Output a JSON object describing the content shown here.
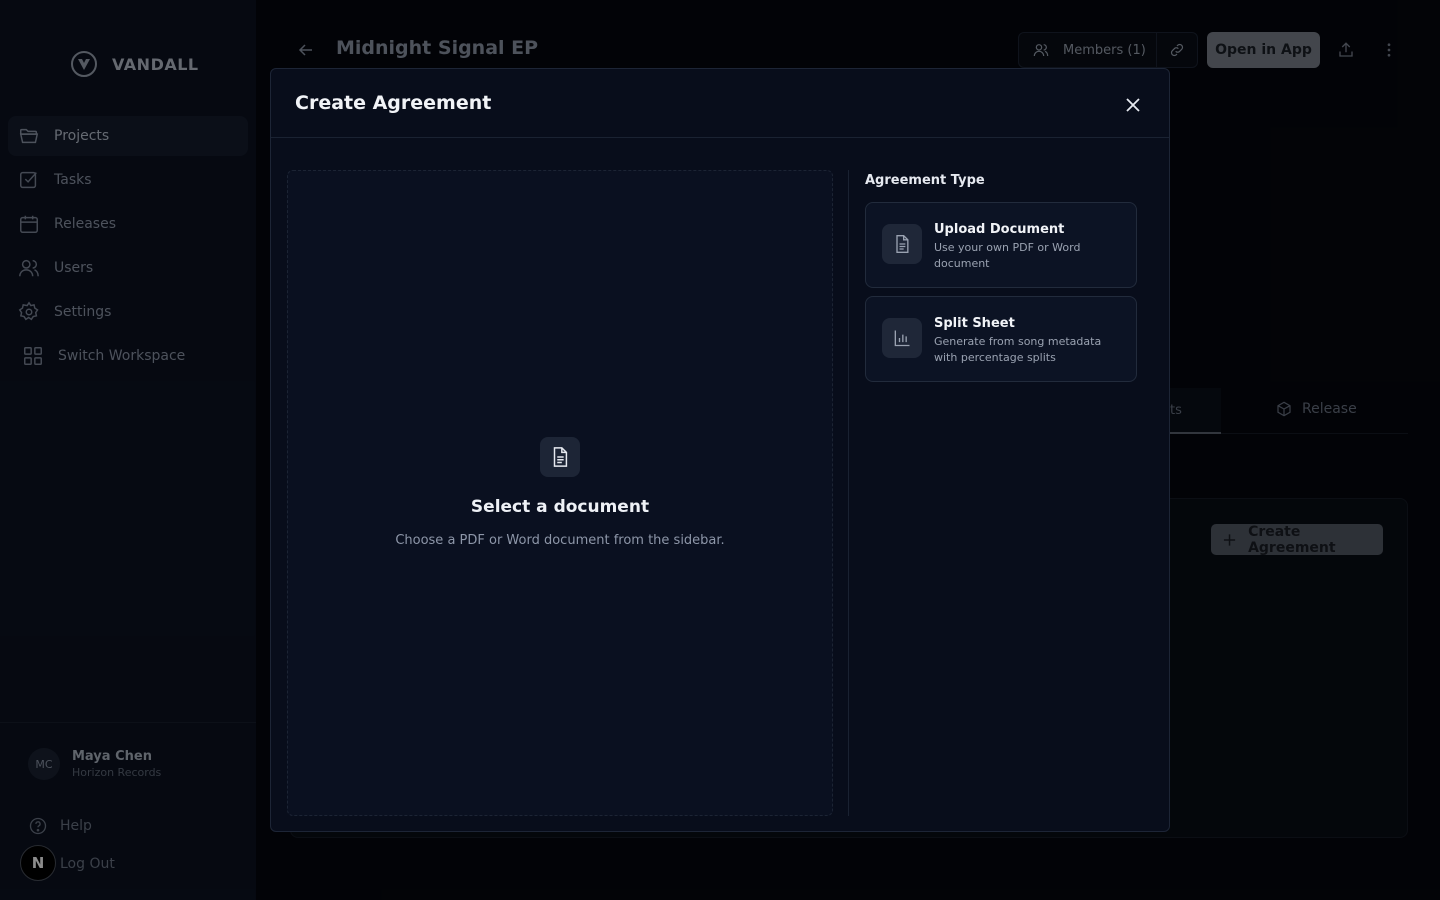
{
  "brand": {
    "name": "VANDALL"
  },
  "sidebar": {
    "items": [
      {
        "label": "Projects",
        "icon": "folder-icon",
        "active": true
      },
      {
        "label": "Tasks",
        "icon": "checkbox-icon"
      },
      {
        "label": "Releases",
        "icon": "calendar-icon"
      },
      {
        "label": "Users",
        "icon": "users-icon"
      },
      {
        "label": "Settings",
        "icon": "gear-icon"
      },
      {
        "label": "Switch Workspace",
        "icon": "grid-icon"
      }
    ],
    "user": {
      "initials": "MC",
      "name": "Maya Chen",
      "org": "Horizon Records"
    },
    "help": "Help",
    "logout": "Log Out",
    "badge": "N"
  },
  "header": {
    "title": "Midnight Signal EP",
    "members": "Members (1)",
    "open_app": "Open in App"
  },
  "background_tabs": {
    "fragment": "ts",
    "release": "Release"
  },
  "background_panel": {
    "create_label": "Create Agreement"
  },
  "modal": {
    "title": "Create Agreement",
    "preview": {
      "title": "Select a document",
      "subtitle": "Choose a PDF or Word document from the sidebar."
    },
    "type_heading": "Agreement Type",
    "types": [
      {
        "title": "Upload Document",
        "desc": "Use your own PDF or Word document",
        "icon": "document-icon"
      },
      {
        "title": "Split Sheet",
        "desc": "Generate from song metadata with percentage splits",
        "icon": "bar-chart-icon"
      }
    ]
  },
  "colors": {
    "background": "#05070d",
    "sidebar": "#0b1220",
    "modal": "#080d1b",
    "accent_muted": "#7a808a"
  }
}
